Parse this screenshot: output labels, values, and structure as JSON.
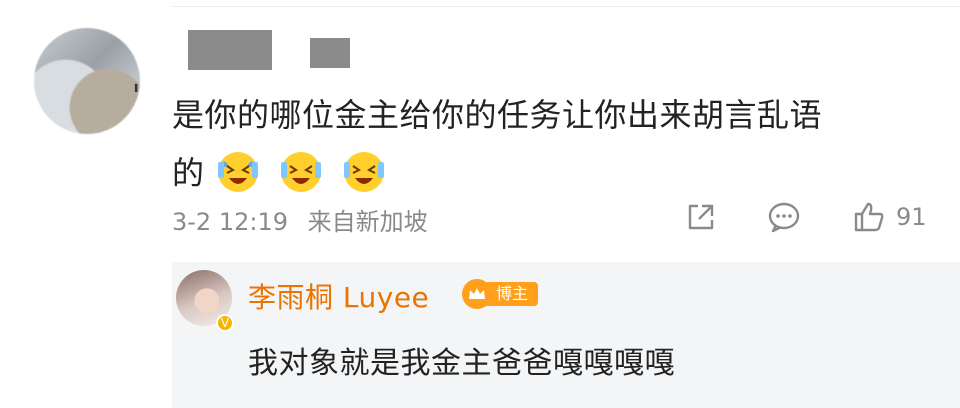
{
  "comment": {
    "text_line1": "是你的哪位金主给你的任务让你出来胡言乱语",
    "text_line2": "的",
    "emojis": [
      "laughing-crying-emoji",
      "laughing-crying-emoji",
      "laughing-crying-emoji"
    ],
    "timestamp": "3-2 12:19",
    "location": "来自新加坡",
    "like_count": "91"
  },
  "reply": {
    "author_name": "李雨桐 Luyee",
    "badge_label": "博主",
    "text": "我对象就是我金主爸爸嘎嘎嘎嘎"
  },
  "colors": {
    "name_accent": "#eb7300",
    "badge_orange": "#ff9f1a",
    "meta_gray": "#8a8a8a"
  }
}
